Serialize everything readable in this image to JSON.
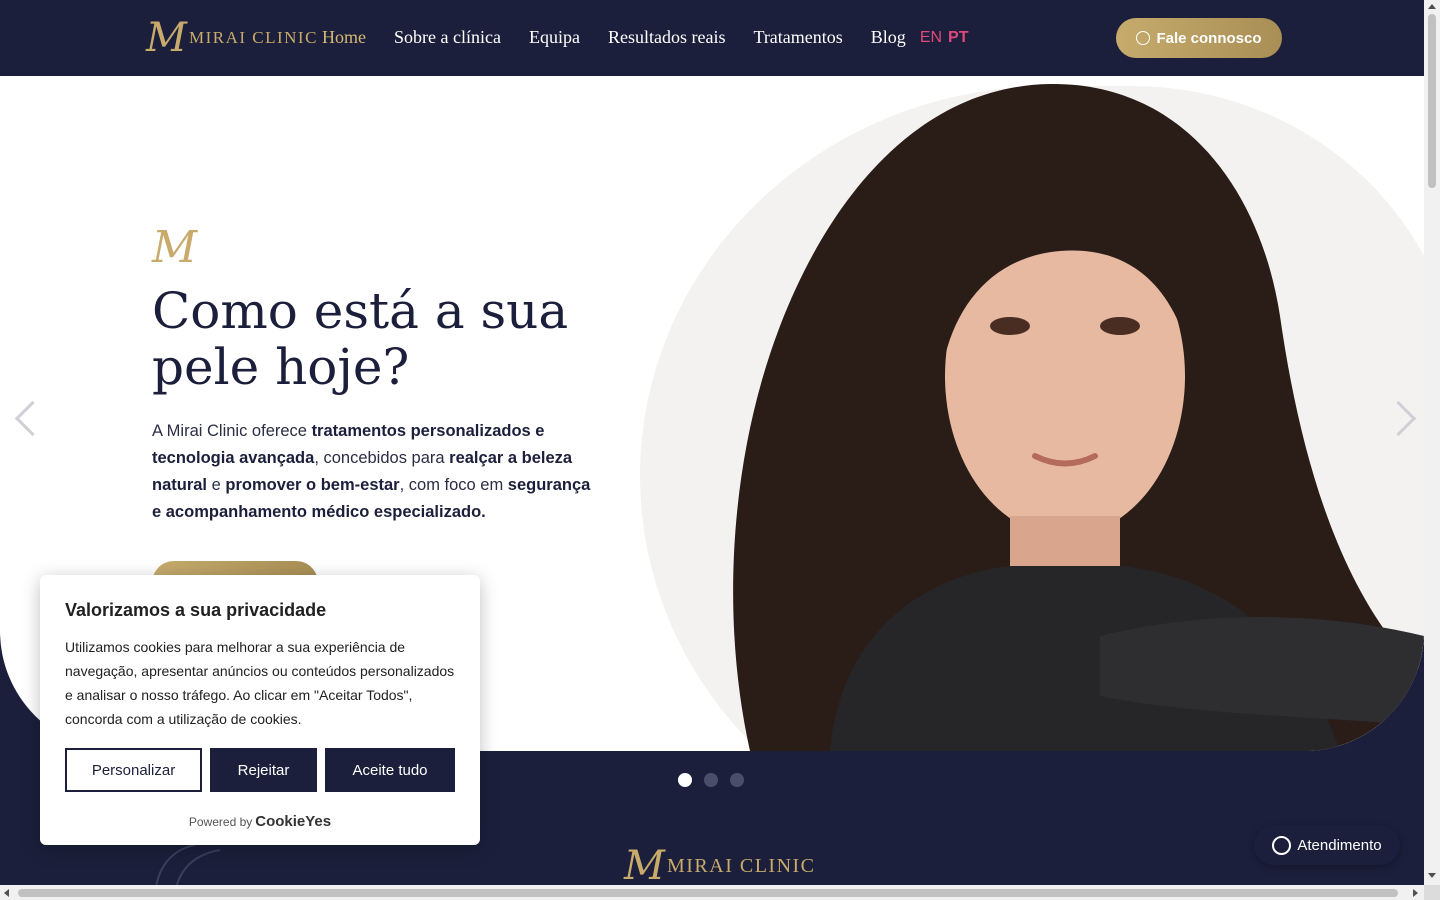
{
  "header": {
    "logo_mark": "M",
    "logo_text": "Mirai Clinic",
    "nav": [
      "Home",
      "Sobre a clínica",
      "Equipa",
      "Resultados reais",
      "Tratamentos",
      "Blog"
    ],
    "lang_en": "EN",
    "lang_pt": "PT",
    "cta_label": "Fale connosco"
  },
  "hero": {
    "mark": "M",
    "title": "Como está a sua pele hoje?",
    "text_parts": [
      "A Mirai Clinic oferece ",
      "tratamentos personalizados e tecnologia avançada",
      ", concebidos para ",
      "realçar a beleza natural",
      " e ",
      "promover o bem-estar",
      ", com foco em ",
      "segurança e acompanhamento médico especializado."
    ],
    "slides_total": 3,
    "active_slide": 1
  },
  "footer_logo": {
    "mark": "M",
    "text": "Mirai Clinic"
  },
  "cookie": {
    "title": "Valorizamos a sua privacidade",
    "text": "Utilizamos cookies para melhorar a sua experiência de navegação, apresentar anúncios ou conteúdos personalizados e analisar o nosso tráfego. Ao clicar em \"Aceitar Todos\", concorda com a utilização de cookies.",
    "btn_customize": "Personalizar",
    "btn_reject": "Rejeitar",
    "btn_accept": "Aceite tudo",
    "powered_by": "Powered by",
    "brand": "CookieYes"
  },
  "whatsapp": {
    "label": "Atendimento"
  },
  "colors": {
    "navy": "#1b1f3b",
    "gold": "#c8ab6b",
    "pink": "#e0487a"
  }
}
